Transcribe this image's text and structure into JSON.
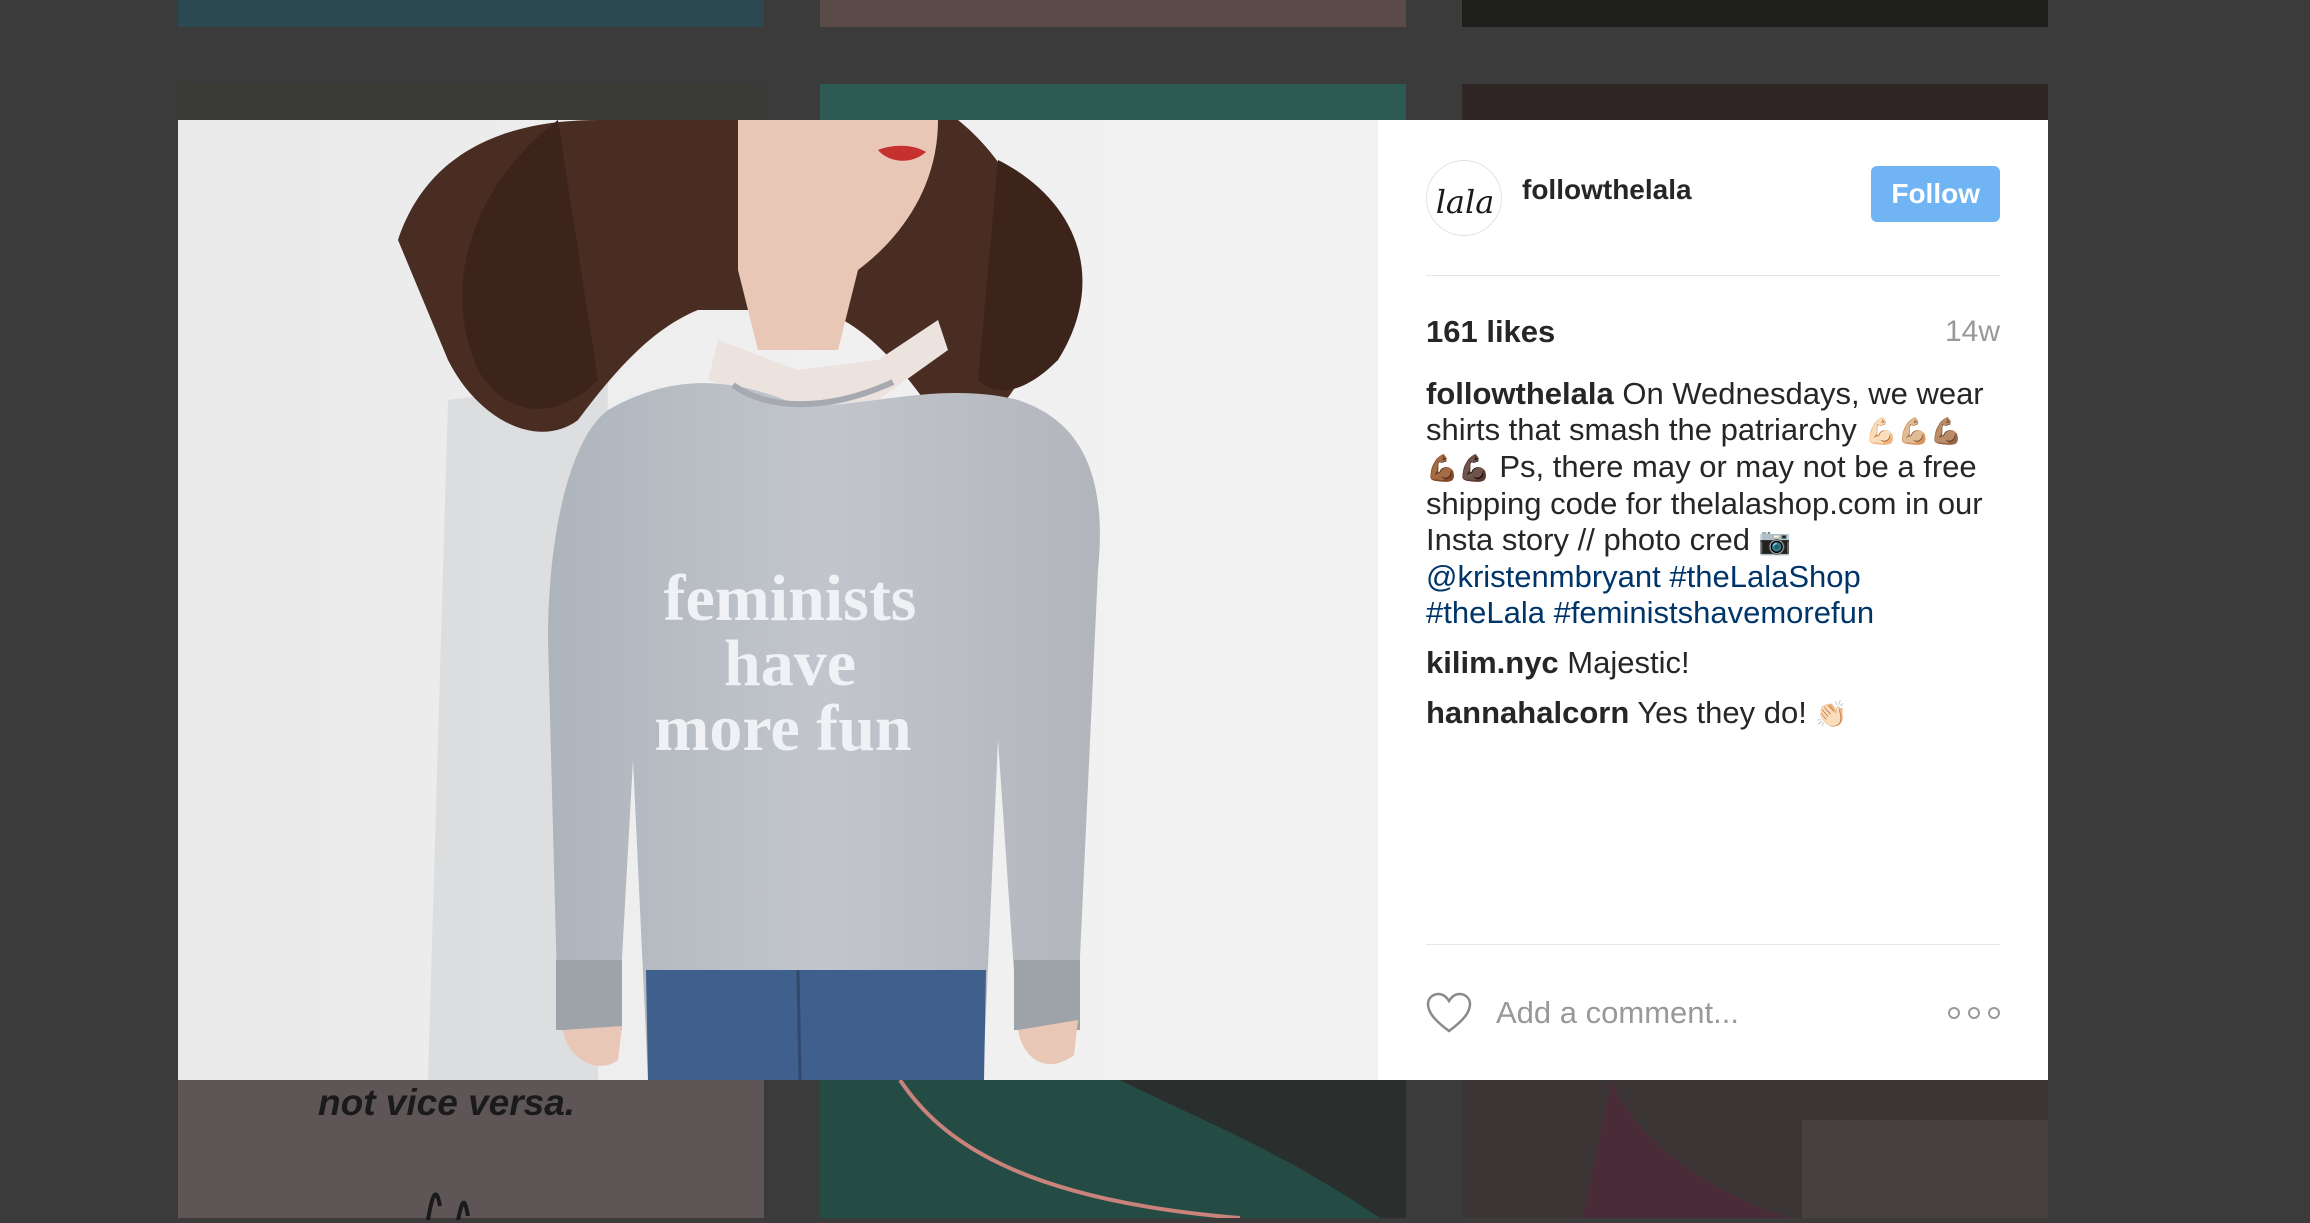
{
  "background": {
    "tile_text": "not vice versa."
  },
  "post": {
    "username": "followthelala",
    "follow_label": "Follow",
    "likes": "161 likes",
    "age": "14w",
    "caption": {
      "author": "followthelala",
      "text": " On Wednesdays, we wear shirts that smash the patriarchy ",
      "emoji1": "💪🏻💪🏼💪🏽 💪🏾💪🏿",
      "text2": " Ps, there may or may not be a free shipping code for thelalashop.com in our Insta story // photo cred ",
      "emoji2": "📷",
      "links": [
        "@kristenmbryant",
        "#theLalaShop",
        "#theLala",
        "#feministshavemorefun"
      ]
    },
    "comments": [
      {
        "author": "kilim.nyc",
        "text": " Majestic!",
        "emoji": ""
      },
      {
        "author": "hannahalcorn",
        "text": " Yes they do! ",
        "emoji": "👏🏻"
      }
    ],
    "comment_placeholder": "Add a comment...",
    "photo_shirt_text": [
      "feminists",
      "have",
      "more fun"
    ],
    "avatar_text": "lala"
  },
  "colors": {
    "follow": "#70b4f4",
    "link": "#003569"
  },
  "icons": [
    "heart-icon",
    "more-options-icon"
  ]
}
